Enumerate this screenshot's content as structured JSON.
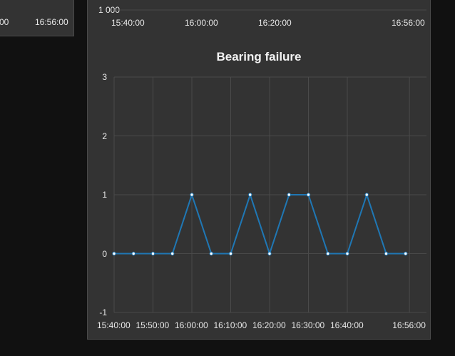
{
  "top_left_panel": {
    "x_ticks": [
      "00",
      "16:56:00"
    ]
  },
  "top_right_panel": {
    "y_ticks": [
      "1 000"
    ],
    "x_ticks": [
      "15:40:00",
      "16:00:00",
      "16:20:00",
      "16:56:00"
    ]
  },
  "chart_data": {
    "type": "line",
    "title": "Bearing failure",
    "xlabel": "",
    "ylabel": "",
    "ylim": [
      -1,
      3
    ],
    "grid": true,
    "colors": {
      "line": "#1f77b4",
      "marker_fill": "#ffffff",
      "grid": "#4a4a4a",
      "panel": "#333333"
    },
    "y_ticks": [
      "3",
      "2",
      "1",
      "0",
      "-1"
    ],
    "x_ticks": [
      "15:40:00",
      "15:50:00",
      "16:00:00",
      "16:10:00",
      "16:20:00",
      "16:30:00",
      "16:40:00",
      "16:56:00"
    ],
    "x": [
      "15:40:00",
      "15:45:00",
      "15:50:00",
      "15:55:00",
      "16:00:00",
      "16:05:00",
      "16:10:00",
      "16:15:00",
      "16:20:00",
      "16:25:00",
      "16:30:00",
      "16:35:00",
      "16:40:00",
      "16:45:00",
      "16:50:00",
      "16:55:00"
    ],
    "values": [
      0,
      0,
      0,
      0,
      1,
      0,
      0,
      1,
      0,
      1,
      1,
      0,
      0,
      1,
      0,
      0
    ]
  }
}
